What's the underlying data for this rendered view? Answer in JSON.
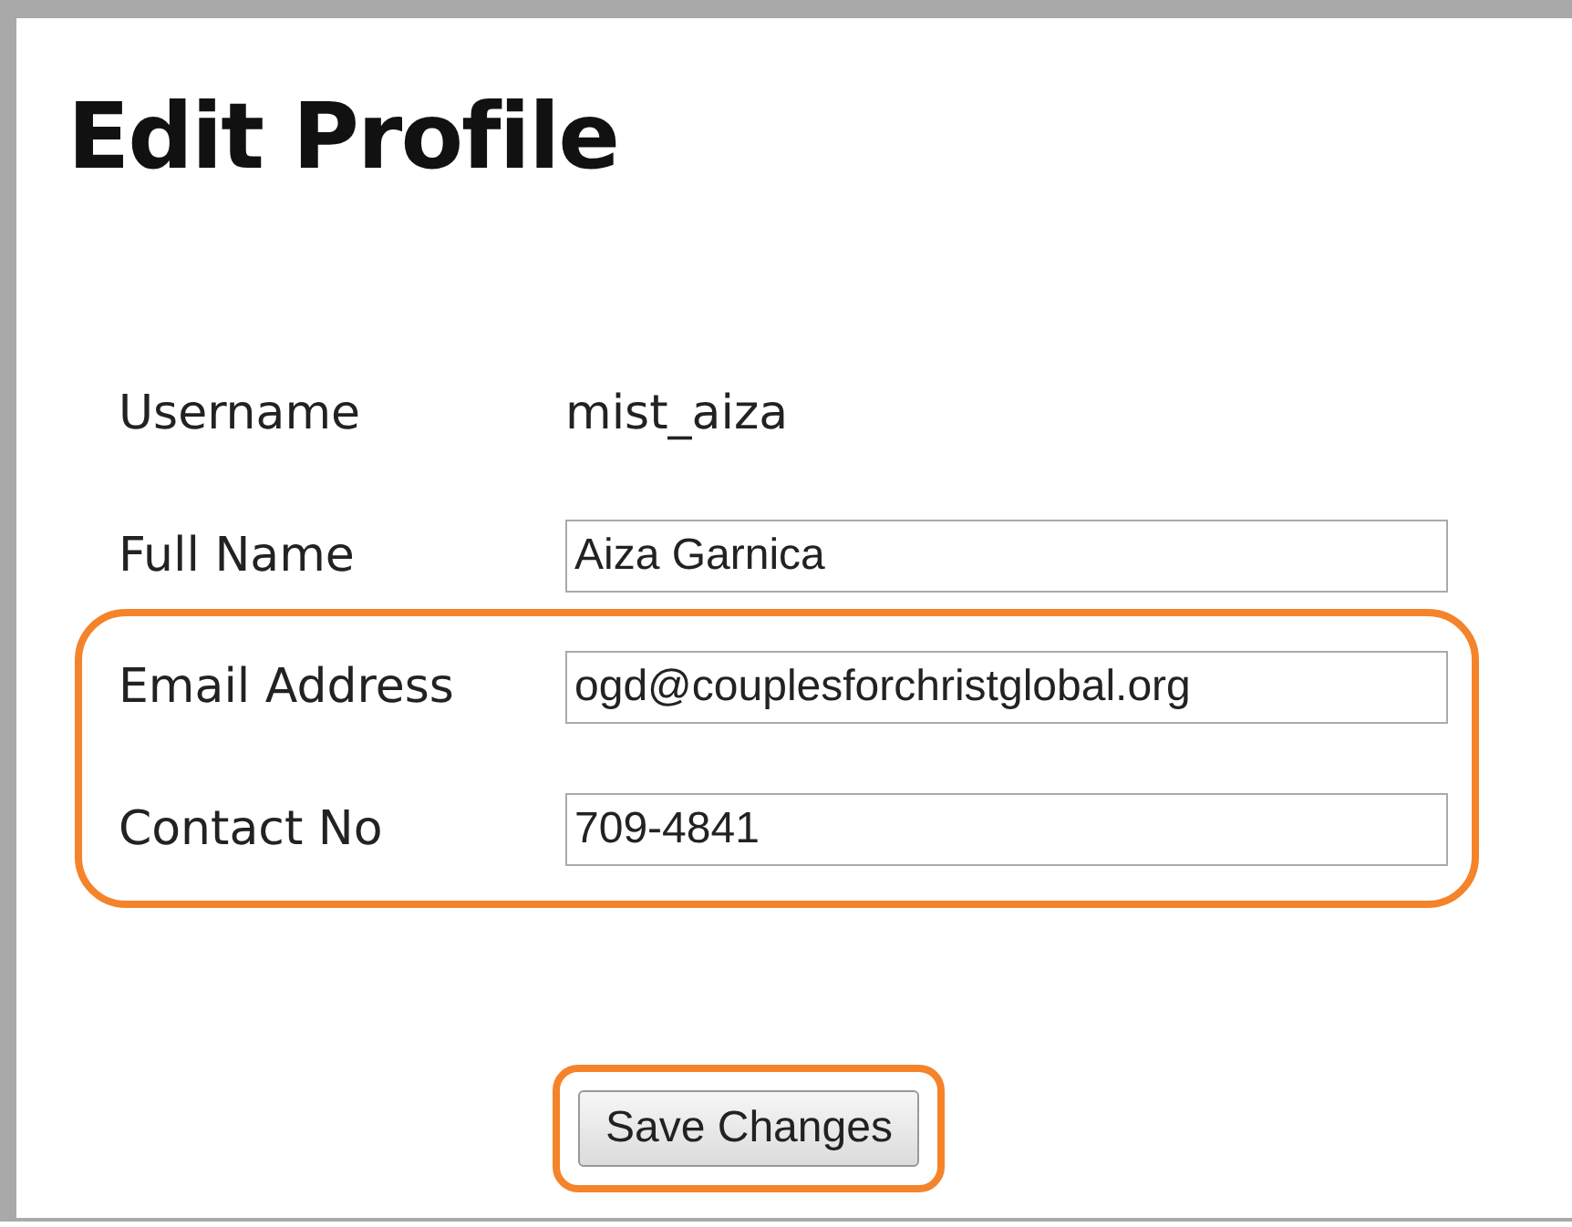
{
  "title": "Edit Profile",
  "groups": [
    {
      "highlighted": false,
      "rows": [
        {
          "kind": "text",
          "label": "Username",
          "value": "mist_aiza"
        },
        {
          "kind": "input",
          "label": "Full Name",
          "value": "Aiza Garnica"
        }
      ]
    },
    {
      "highlighted": true,
      "rows": [
        {
          "kind": "input",
          "label": "Email Address",
          "value": "ogd@couplesforchristglobal.org"
        },
        {
          "kind": "input",
          "label": "Contact No",
          "value": "709-4841"
        }
      ]
    }
  ],
  "button": {
    "label": "Save Changes",
    "highlighted": true
  }
}
